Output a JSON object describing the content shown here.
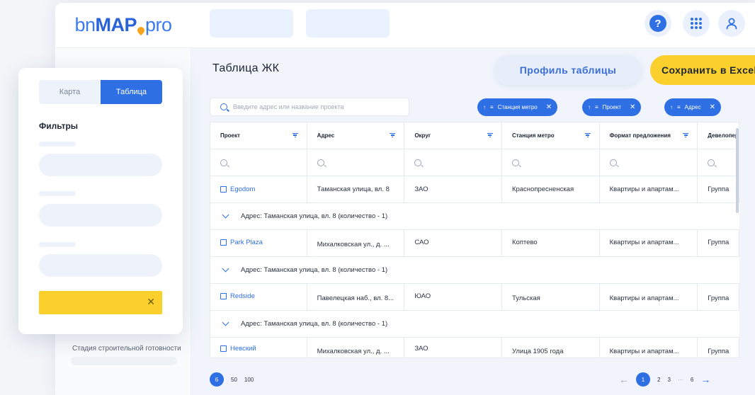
{
  "logo": {
    "part1": "bn",
    "part2": "MAP",
    "part3": "pro"
  },
  "side": {
    "caption": "Стадия строительной готовности"
  },
  "header": {
    "help_label": "?"
  },
  "main": {
    "title": "Таблица ЖК",
    "profile_button": "Профиль таблицы",
    "save_button": "Сохранить в Excel",
    "search_placeholder": "Введите адрес или название проекта",
    "chips": [
      {
        "label": "Станция метро"
      },
      {
        "label": "Проект"
      },
      {
        "label": "Адрес"
      }
    ]
  },
  "table": {
    "columns": [
      "Проект",
      "Адрес",
      "Округ",
      "Станция метро",
      "Формат предложения",
      "Девелопер"
    ],
    "rows": [
      {
        "project": "Egodom",
        "address": "Таманская улица, вл. 8",
        "district": "ЗАО",
        "metro": "Краснопресненская",
        "format": "Квартиры и апартам...",
        "developer": "Группа"
      },
      {
        "group": "Адрес: Таманская улица, вл. 8 (количество - 1)"
      },
      {
        "project": "Park Plaza",
        "address": "Михалковская ул., д. ...",
        "district": "САО",
        "metro": "Коптево",
        "format": "Квартиры и апартам...",
        "developer": "Группа"
      },
      {
        "group": "Адрес: Таманская улица, вл. 8 (количество - 1)"
      },
      {
        "project": "Redside",
        "address": "Павелецкая наб., вл. 8...",
        "district": "ЮАО",
        "metro": "Тульская",
        "format": "Квартиры и апартам...",
        "developer": "Группа"
      },
      {
        "group": "Адрес: Таманская улица, вл. 8 (количество - 1)"
      },
      {
        "project": "Невский",
        "address": "Михалковская ул., д. ...",
        "district": "ЗАО",
        "metro": "Улица 1905 года",
        "format": "Квартиры и апартам...",
        "developer": "Группа"
      }
    ]
  },
  "pagination": {
    "per_page": [
      "6",
      "50",
      "100"
    ],
    "pages": [
      "1",
      "2",
      "3",
      "···",
      "6"
    ],
    "prev": "←",
    "next": "→"
  },
  "panel": {
    "tab_map": "Карта",
    "tab_table": "Таблица",
    "title": "Фильтры",
    "clear": "✕"
  }
}
